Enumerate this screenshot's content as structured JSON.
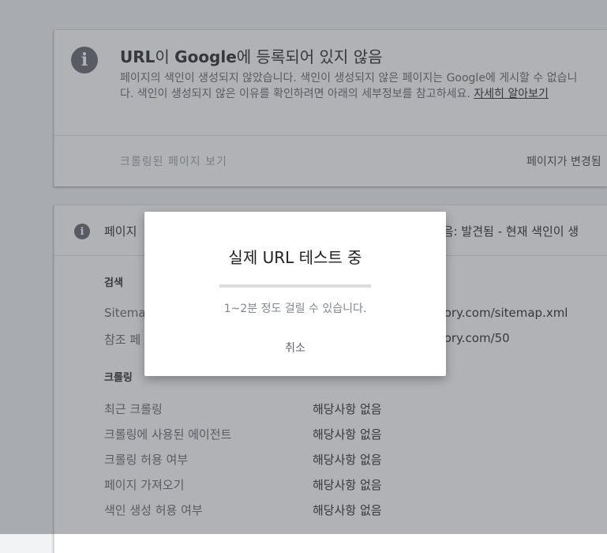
{
  "card1": {
    "title_prefix": "URL",
    "title_mid1": "이 ",
    "title_brand": "Google",
    "title_suffix": "에 등록되어 있지 않음",
    "desc": "페이지의 색인이 생성되지 않았습니다. 색인이 생성되지 않은 페이지는 Google에 게시할 수 없습니다. 색인이 생성되지 않은 이유를 확인하려면 아래의 세부정보를 참고하세요.",
    "learn_more": "자세히 알아보기",
    "crawled_link": "크롤링된 페이지 보기",
    "changed_text": "페이지가 변경됨"
  },
  "card2": {
    "title": "페이지",
    "status": "않음: 발견됨 - 현재 색인이 생",
    "search_heading": "검색",
    "sitemap_label": "Sitemap",
    "sitemap_value": "story.com/sitemap.xml",
    "referer_label": "참조 페",
    "referer_value": "story.com/50",
    "crawl_heading": "크롤링",
    "rows": [
      {
        "label": "최근 크롤링",
        "value": "해당사항 없음"
      },
      {
        "label": "크롤링에 사용된 에이전트",
        "value": "해당사항 없음"
      },
      {
        "label": "크롤링 허용 여부",
        "value": "해당사항 없음"
      },
      {
        "label": "페이지 가져오기",
        "value": "해당사항 없음"
      },
      {
        "label": "색인 생성 허용 여부",
        "value": "해당사항 없음"
      }
    ]
  },
  "dialog": {
    "title": "실제 URL 테스트 중",
    "progress_percent": 100,
    "subtitle": "1~2분 정도 걸릴 수 있습니다.",
    "cancel": "취소"
  }
}
